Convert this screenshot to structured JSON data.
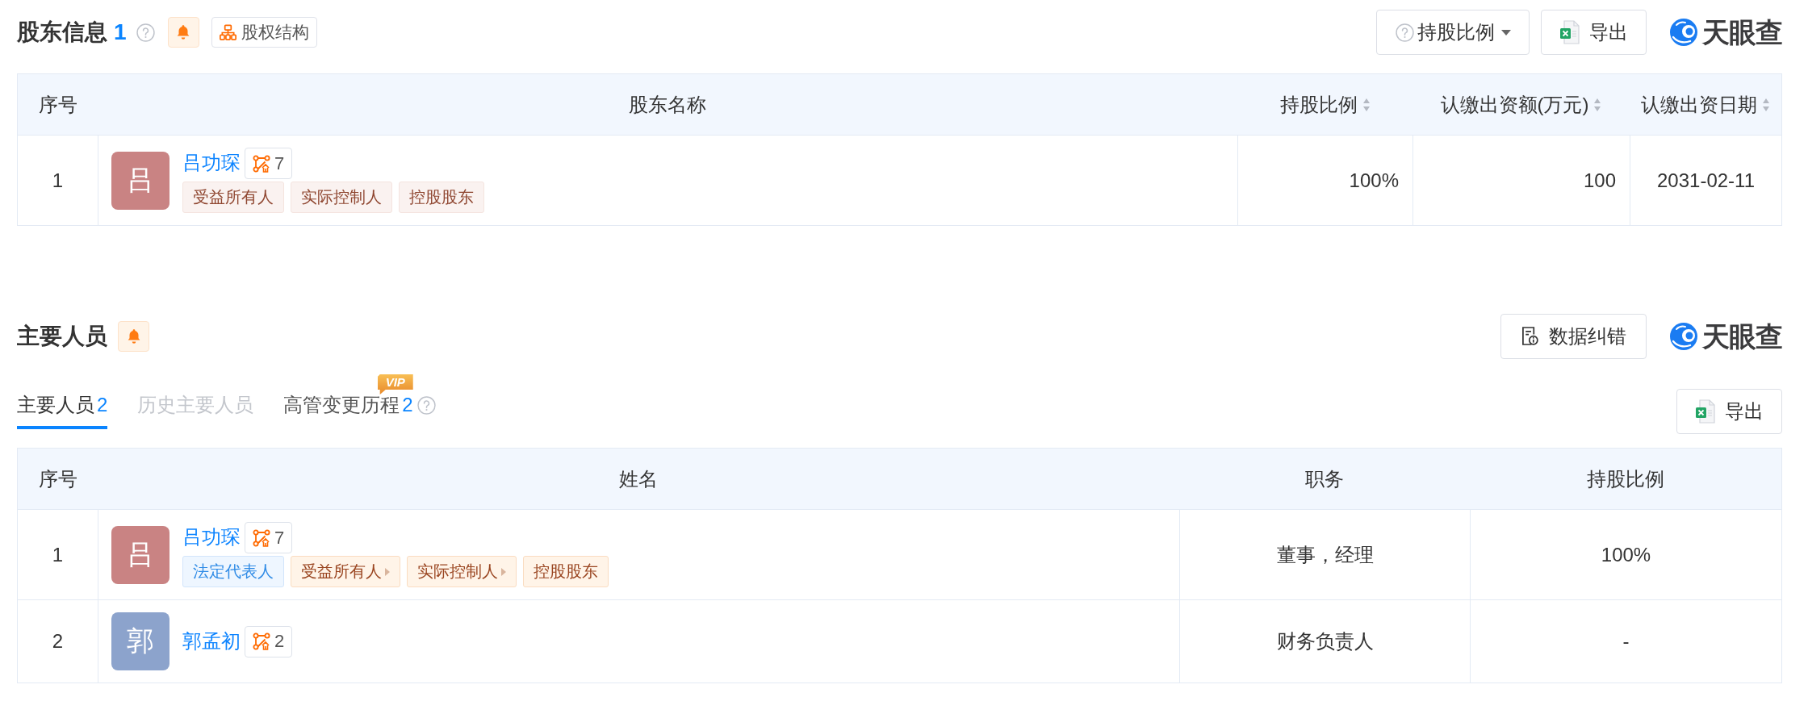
{
  "shareholders": {
    "title": "股东信息",
    "count": "1",
    "structure_button": "股权结构",
    "ratio_filter": "持股比例",
    "export_button": "导出",
    "logo": "天眼查",
    "table": {
      "columns": [
        {
          "label": "序号",
          "kind": "index",
          "sortable": false
        },
        {
          "label": "股东名称",
          "kind": "person",
          "sortable": false
        },
        {
          "label": "持股比例",
          "kind": "number",
          "sortable": true
        },
        {
          "label": "认缴出资额(万元)",
          "kind": "number",
          "sortable": true
        },
        {
          "label": "认缴出资日期",
          "kind": "date",
          "sortable": true
        }
      ],
      "rows": [
        {
          "cells": [
            "1",
            {
              "avatar": "吕",
              "color": "#c98383",
              "name": "吕功琛",
              "links": "7",
              "tags": [
                {
                  "label": "受益所有人",
                  "kind": "plain",
                  "expandable": false
                },
                {
                  "label": "实际控制人",
                  "kind": "plain",
                  "expandable": false
                },
                {
                  "label": "控股股东",
                  "kind": "plain",
                  "expandable": false
                }
              ]
            },
            "100%",
            "100",
            "2031-02-11"
          ]
        }
      ]
    }
  },
  "key_personnel": {
    "title": "主要人员",
    "correction_button": "数据纠错",
    "logo": "天眼查",
    "tabs": [
      {
        "label": "主要人员",
        "count": "2",
        "selected": true,
        "disabled": false,
        "help": false
      },
      {
        "label": "历史主要人员",
        "selected": false,
        "disabled": true,
        "help": false
      },
      {
        "label": "高管变更历程",
        "count": "2",
        "badge": "VIP",
        "selected": false,
        "disabled": false,
        "help": true
      }
    ],
    "export_button": "导出",
    "table": {
      "columns": [
        {
          "label": "序号",
          "kind": "index",
          "sortable": false
        },
        {
          "label": "姓名",
          "kind": "person",
          "sortable": false
        },
        {
          "label": "职务",
          "kind": "text",
          "sortable": false
        },
        {
          "label": "持股比例",
          "kind": "text",
          "sortable": false
        }
      ],
      "rows": [
        {
          "cells": [
            "1",
            {
              "avatar": "吕",
              "color": "#c98383",
              "name": "吕功琛",
              "links": "7",
              "tags": [
                {
                  "label": "法定代表人",
                  "kind": "legal",
                  "expandable": false
                },
                {
                  "label": "受益所有人",
                  "kind": "role",
                  "expandable": true
                },
                {
                  "label": "实际控制人",
                  "kind": "role",
                  "expandable": true
                },
                {
                  "label": "控股股东",
                  "kind": "role",
                  "expandable": false
                }
              ]
            },
            "董事，经理",
            "100%"
          ]
        },
        {
          "cells": [
            "2",
            {
              "avatar": "郭",
              "color": "#8ca3cc",
              "name": "郭孟初",
              "links": "2"
            },
            "财务负责人",
            "-"
          ]
        }
      ]
    }
  }
}
